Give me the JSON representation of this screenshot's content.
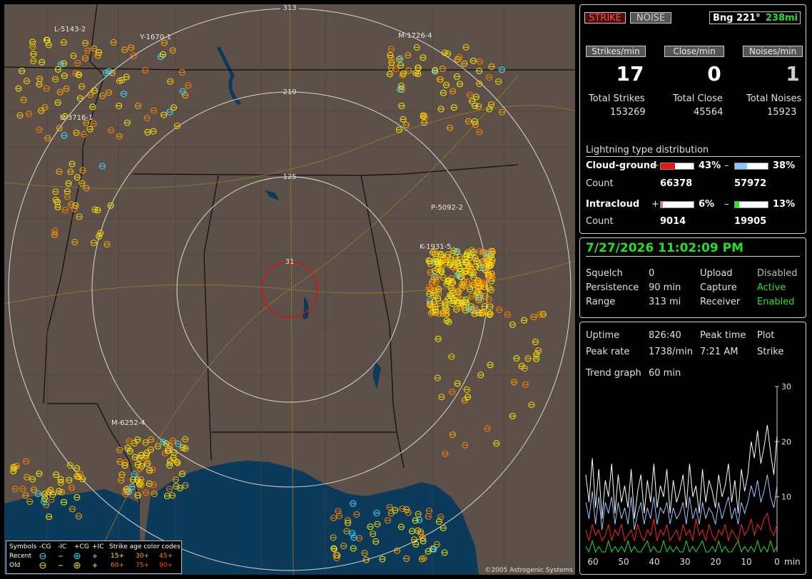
{
  "map": {
    "range_labels": [
      "313",
      "219",
      "125",
      "31"
    ],
    "station_labels": [
      "L-5143-2",
      "Y-1670-1",
      "M-1726-4",
      "U-3716-1",
      "P-5092-2",
      "K-1931-5",
      "M-6252-4"
    ],
    "copyright": "©2005 Astrogenic Systems",
    "legend": {
      "title_symbols": "Symbols",
      "cols": [
        "-CG",
        "-IC",
        "+CG",
        "+IC"
      ],
      "title_age": "Strike age color codes",
      "rows": [
        {
          "label": "Recent",
          "ages": [
            "15+",
            "30+",
            "45+"
          ]
        },
        {
          "label": "Old",
          "ages": [
            "60+",
            "75+",
            "90+"
          ]
        }
      ]
    },
    "colors": {
      "land": "#5c5048",
      "water": "#0c3a5a",
      "recent": "#ffee00",
      "mid": "#ffaa00",
      "old": "#ff8000",
      "ic": "#40e0ff"
    }
  },
  "panel1": {
    "strike_tab": "STRIKE",
    "noise_tab": "NOISE",
    "bearing": "Bng 221°",
    "distance": "238mi",
    "strikes_per_min_label": "Strikes/min",
    "close_per_min_label": "Close/min",
    "noises_per_min_label": "Noises/min",
    "strikes_per_min": "17",
    "close_per_min": "0",
    "noises_per_min": "1",
    "total_strikes_label": "Total Strikes",
    "total_close_label": "Total Close",
    "total_noises_label": "Total Noises",
    "total_strikes": "153269",
    "total_close": "45564",
    "total_noises": "15923",
    "dist_title": "Lightning type distribution",
    "cg_label": "Cloud-ground",
    "ic_label": "Intracloud",
    "count_label": "Count",
    "plus": "+",
    "minus": "–",
    "cg_pos_pct": "43%",
    "cg_neg_pct": "38%",
    "cg_pos_count": "66378",
    "cg_neg_count": "57972",
    "ic_pos_pct": "6%",
    "ic_neg_pct": "13%",
    "ic_pos_count": "9014",
    "ic_neg_count": "19905",
    "bar_fill": {
      "cg_pos": 0.43,
      "cg_neg": 0.38,
      "ic_pos": 0.06,
      "ic_neg": 0.13
    },
    "bar_colors": {
      "cg_pos": "#ee1111",
      "cg_neg": "#88c8ff",
      "ic_pos": "#e07090",
      "ic_neg": "#22ee22"
    }
  },
  "panel2": {
    "datetime": "7/27/2026 11:02:09 PM",
    "squelch_label": "Squelch",
    "squelch": "0",
    "persistence_label": "Persistence",
    "persistence": "90 min",
    "range_label": "Range",
    "range": "313 mi",
    "upload_label": "Upload",
    "upload": "Disabled",
    "capture_label": "Capture",
    "capture": "Active",
    "receiver_label": "Receiver",
    "receiver": "Enabled"
  },
  "panel3": {
    "uptime_label": "Uptime",
    "uptime": "826:40",
    "peak_time_label": "Peak time",
    "peak_time": "7:21 AM",
    "plot_label": "Plot",
    "plot": "Strike",
    "peak_rate_label": "Peak rate",
    "peak_rate": "1738/min",
    "trend_label": "Trend graph",
    "trend": "60 min",
    "chart_data": {
      "type": "line",
      "x_ticks": [
        "60",
        "50",
        "40",
        "30",
        "20",
        "10",
        "0"
      ],
      "x_unit": "min",
      "y_ticks": [
        "30",
        "20",
        "10"
      ],
      "ylim": [
        0,
        30
      ],
      "series": [
        {
          "color": "#ffffff",
          "values": [
            14,
            9,
            17,
            8,
            15,
            6,
            13,
            10,
            16,
            7,
            14,
            9,
            12,
            8,
            15,
            6,
            11,
            14,
            7,
            13,
            9,
            16,
            8,
            12,
            10,
            15,
            7,
            13,
            9,
            11,
            14,
            8,
            16,
            10,
            12,
            7,
            15,
            9,
            13,
            11,
            8,
            14,
            10,
            12,
            16,
            9,
            13,
            7,
            15,
            11,
            14,
            20,
            17,
            22,
            16,
            19,
            23,
            18,
            14,
            21
          ]
        },
        {
          "color": "#9ec8ff",
          "values": [
            9,
            6,
            11,
            5,
            10,
            4,
            9,
            7,
            10,
            5,
            9,
            6,
            8,
            5,
            10,
            4,
            7,
            9,
            5,
            8,
            6,
            10,
            5,
            8,
            7,
            9,
            5,
            8,
            6,
            7,
            9,
            5,
            10,
            6,
            8,
            5,
            9,
            6,
            8,
            7,
            5,
            9,
            6,
            8,
            10,
            6,
            8,
            5,
            9,
            7,
            9,
            12,
            10,
            13,
            9,
            11,
            14,
            10,
            8,
            12
          ]
        },
        {
          "color": "#ff2020",
          "values": [
            4,
            2,
            5,
            3,
            4,
            2,
            3,
            5,
            2,
            4,
            3,
            5,
            2,
            3,
            4,
            2,
            5,
            3,
            2,
            4,
            3,
            6,
            2,
            4,
            3,
            5,
            2,
            3,
            4,
            2,
            5,
            3,
            4,
            2,
            6,
            3,
            4,
            2,
            5,
            3,
            2,
            4,
            3,
            5,
            2,
            4,
            3,
            2,
            5,
            3,
            4,
            6,
            3,
            5,
            4,
            6,
            7,
            4,
            3,
            5
          ]
        },
        {
          "color": "#22e022",
          "values": [
            1,
            0,
            2,
            0,
            1,
            0,
            0,
            2,
            0,
            1,
            0,
            1,
            0,
            2,
            0,
            1,
            0,
            0,
            1,
            2,
            0,
            1,
            0,
            0,
            2,
            0,
            1,
            0,
            1,
            0,
            0,
            2,
            0,
            1,
            0,
            1,
            2,
            0,
            0,
            1,
            0,
            2,
            0,
            1,
            0,
            0,
            1,
            2,
            0,
            1,
            0,
            1,
            0,
            2,
            0,
            1,
            0,
            2,
            0,
            1
          ]
        }
      ]
    }
  }
}
